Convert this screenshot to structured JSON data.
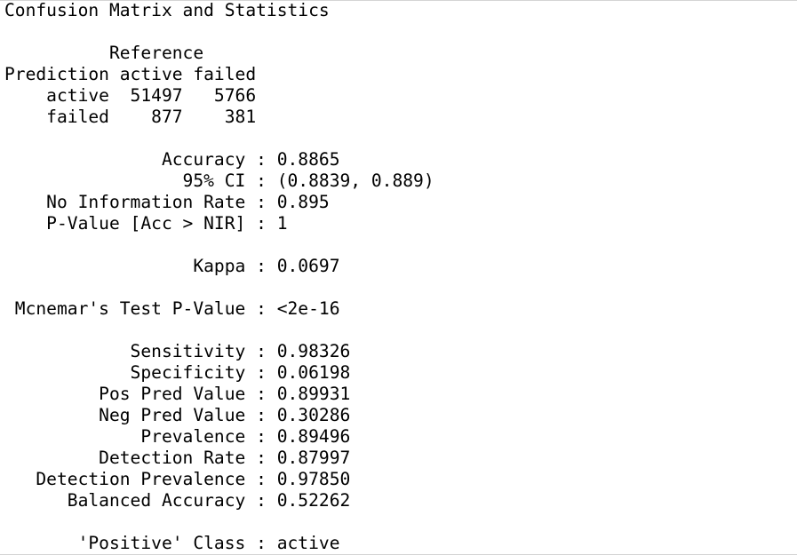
{
  "console": {
    "title": "Confusion Matrix and Statistics",
    "matrix": {
      "reference_label": "          Reference",
      "header_row": "Prediction active failed",
      "rows": [
        "    active  51497   5766",
        "    failed    877    381"
      ]
    },
    "overall_stats": [
      "               Accuracy : 0.8865",
      "                 95% CI : (0.8839, 0.889)",
      "    No Information Rate : 0.895",
      "    P-Value [Acc > NIR] : 1"
    ],
    "kappa": "                  Kappa : 0.0697",
    "mcnemar": " Mcnemar's Test P-Value : <2e-16",
    "class_stats": [
      "            Sensitivity : 0.98326",
      "            Specificity : 0.06198",
      "         Pos Pred Value : 0.89931",
      "         Neg Pred Value : 0.30286",
      "             Prevalence : 0.89496",
      "         Detection Rate : 0.87997",
      "   Detection Prevalence : 0.97850",
      "      Balanced Accuracy : 0.52262"
    ],
    "positive_class": "       'Positive' Class : active"
  }
}
